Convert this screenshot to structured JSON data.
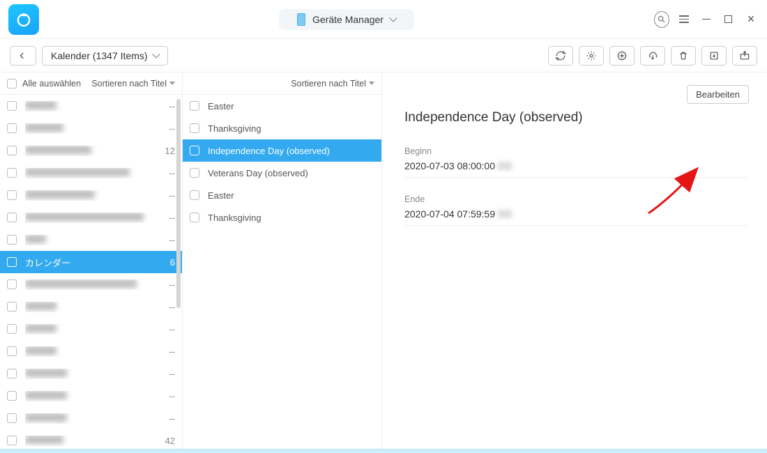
{
  "titlebar": {
    "device_label": "Geräte Manager"
  },
  "toolbar": {
    "breadcrumb": "Kalender (1347 Items)"
  },
  "col1": {
    "select_all": "Alle auswählen",
    "sort_label": "Sortieren nach Titel",
    "items": [
      {
        "label": "",
        "count": "--",
        "blur_w": 45,
        "selected": false
      },
      {
        "label": "",
        "count": "--",
        "blur_w": 55,
        "selected": false
      },
      {
        "label": "",
        "count": "12",
        "blur_w": 95,
        "selected": false
      },
      {
        "label": "",
        "count": "--",
        "blur_w": 150,
        "selected": false
      },
      {
        "label": "",
        "count": "--",
        "blur_w": 100,
        "selected": false
      },
      {
        "label": "",
        "count": "--",
        "blur_w": 170,
        "selected": false
      },
      {
        "label": "",
        "count": "--",
        "blur_w": 30,
        "selected": false
      },
      {
        "label": "カレンダー",
        "count": "6",
        "blur_w": 0,
        "selected": true
      },
      {
        "label": "",
        "count": "--",
        "blur_w": 160,
        "selected": false
      },
      {
        "label": "",
        "count": "--",
        "blur_w": 45,
        "selected": false
      },
      {
        "label": "",
        "count": "--",
        "blur_w": 45,
        "selected": false
      },
      {
        "label": "",
        "count": "--",
        "blur_w": 45,
        "selected": false
      },
      {
        "label": "",
        "count": "--",
        "blur_w": 60,
        "selected": false
      },
      {
        "label": "",
        "count": "--",
        "blur_w": 60,
        "selected": false
      },
      {
        "label": "",
        "count": "--",
        "blur_w": 60,
        "selected": false
      },
      {
        "label": "",
        "count": "42",
        "blur_w": 55,
        "selected": false
      }
    ]
  },
  "col2": {
    "sort_label": "Sortieren nach Titel",
    "items": [
      {
        "label": "Easter",
        "selected": false
      },
      {
        "label": "Thanksgiving",
        "selected": false
      },
      {
        "label": "Independence Day (observed)",
        "selected": true
      },
      {
        "label": "Veterans Day (observed)",
        "selected": false
      },
      {
        "label": "Easter",
        "selected": false
      },
      {
        "label": "Thanksgiving",
        "selected": false
      }
    ]
  },
  "detail": {
    "edit_label": "Bearbeiten",
    "title": "Independence Day (observed)",
    "begin_label": "Beginn",
    "begin_value": "2020-07-03 08:00:00",
    "end_label": "Ende",
    "end_value": "2020-07-04 07:59:59"
  }
}
